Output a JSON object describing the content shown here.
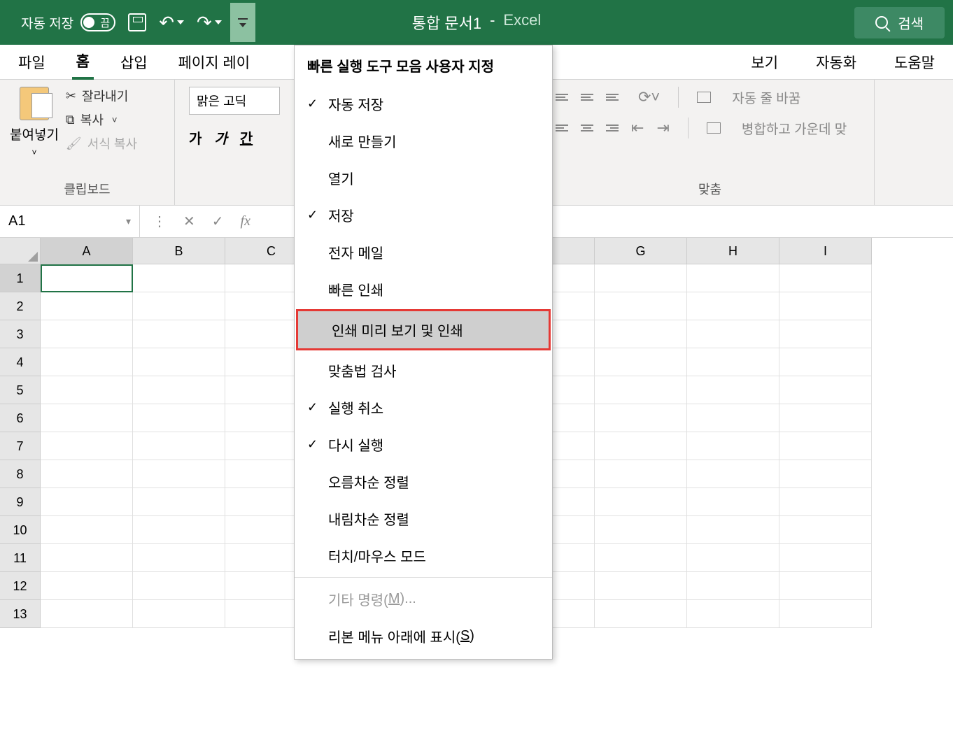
{
  "titlebar": {
    "autosave_label": "자동 저장",
    "autosave_state": "끔",
    "doc_title": "통합 문서1",
    "title_sep": "-",
    "app_name": "Excel",
    "search_label": "검색"
  },
  "ribbon_tabs": {
    "file": "파일",
    "home": "홈",
    "insert": "삽입",
    "page_layout": "페이지 레이",
    "view": "보기",
    "automate": "자동화",
    "help": "도움말"
  },
  "ribbon": {
    "clipboard": {
      "paste": "붙여넣기",
      "cut": "잘라내기",
      "copy": "복사",
      "format_painter": "서식 복사",
      "group_label": "클립보드"
    },
    "font": {
      "font_name": "맑은 고딕",
      "bold": "가",
      "italic": "가",
      "underline": "간"
    },
    "alignment": {
      "wrap": "자동 줄 바꿈",
      "merge": "병합하고 가운데 맞",
      "group_label": "맞춤"
    }
  },
  "formula_bar": {
    "name_box": "A1"
  },
  "grid": {
    "columns": [
      "A",
      "B",
      "C",
      "",
      "",
      "",
      "G",
      "H",
      "I"
    ],
    "rows": [
      "1",
      "2",
      "3",
      "4",
      "5",
      "6",
      "7",
      "8",
      "9",
      "10",
      "11",
      "12",
      "13"
    ]
  },
  "qat_menu": {
    "title": "빠른 실행 도구 모음 사용자 지정",
    "items": [
      {
        "label": "자동 저장",
        "checked": true
      },
      {
        "label": "새로 만들기",
        "checked": false
      },
      {
        "label": "열기",
        "checked": false
      },
      {
        "label": "저장",
        "checked": true
      },
      {
        "label": "전자 메일",
        "checked": false
      },
      {
        "label": "빠른 인쇄",
        "checked": false
      },
      {
        "label": "인쇄 미리 보기 및 인쇄",
        "checked": false,
        "highlighted": true
      },
      {
        "label": "맞춤법 검사",
        "checked": false
      },
      {
        "label": "실행 취소",
        "checked": true
      },
      {
        "label": "다시 실행",
        "checked": true
      },
      {
        "label": "오름차순 정렬",
        "checked": false
      },
      {
        "label": "내림차순 정렬",
        "checked": false
      },
      {
        "label": "터치/마우스 모드",
        "checked": false
      }
    ],
    "more_commands_prefix": "기타 명령(",
    "more_commands_key": "M",
    "more_commands_suffix": ")...",
    "show_below_prefix": "리본 메뉴 아래에 표시(",
    "show_below_key": "S",
    "show_below_suffix": ")"
  }
}
